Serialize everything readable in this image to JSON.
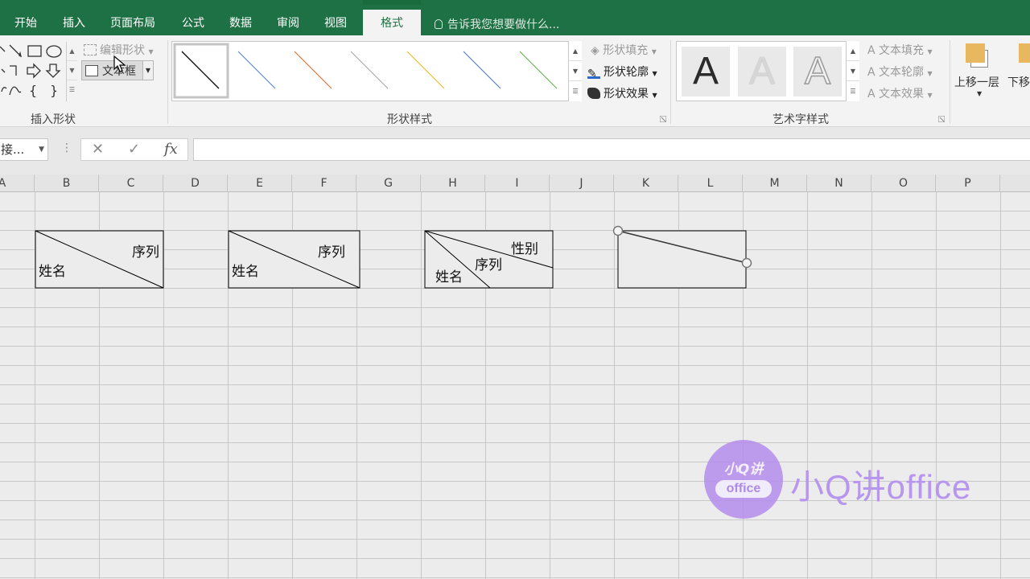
{
  "tabs": {
    "home": "开始",
    "insert": "插入",
    "layout": "页面布局",
    "formulas": "公式",
    "data": "数据",
    "review": "审阅",
    "view": "视图",
    "format": "格式",
    "tell_me": "告诉我您想要做什么..."
  },
  "ribbon": {
    "edit_shape": "编辑形状",
    "textbox": "文本框",
    "insert_shapes_label": "插入形状",
    "shape_styles_label": "形状样式",
    "shape_fill": "形状填充",
    "shape_outline": "形状轮廓",
    "shape_effects": "形状效果",
    "wordart_glyph": "A",
    "text_fill": "文本填充",
    "text_outline": "文本轮廓",
    "text_effects": "文本效果",
    "wordart_label": "艺术字样式",
    "bring_forward": "上移一层",
    "send_backward": "下移",
    "style_line_colors": [
      "#000000",
      "#4a7ec8",
      "#e06a2c",
      "#a0a0a0",
      "#f0b820",
      "#4472c4",
      "#5eae4a"
    ]
  },
  "formula_bar": {
    "name_box": "接...",
    "cancel": "✕",
    "enter": "✓",
    "fx": "fx",
    "value": ""
  },
  "columns": [
    "A",
    "B",
    "C",
    "D",
    "E",
    "F",
    "G",
    "H",
    "I",
    "J",
    "K",
    "L",
    "M",
    "N",
    "O",
    "P"
  ],
  "cells": {
    "box1": {
      "top_right": "序列",
      "bottom_left": "姓名"
    },
    "box2": {
      "top_right": "序列",
      "bottom_left": "姓名"
    },
    "box3": {
      "top": "性别",
      "middle": "序列",
      "bottom_left": "姓名"
    }
  },
  "watermark": {
    "logo_line1": "小Q讲",
    "logo_line2": "office",
    "text": "小Q讲office"
  }
}
